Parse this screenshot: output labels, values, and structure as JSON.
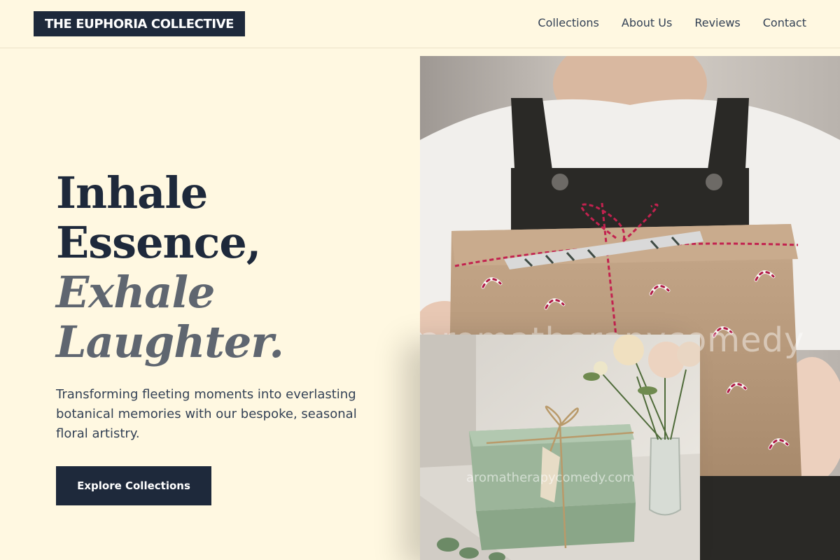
{
  "brand": {
    "name": "THE EUPHORIA COLLECTIVE"
  },
  "nav": {
    "items": [
      {
        "label": "Collections"
      },
      {
        "label": "About Us"
      },
      {
        "label": "Reviews"
      },
      {
        "label": "Contact"
      }
    ]
  },
  "hero": {
    "headline": {
      "line1": "Inhale",
      "line2": "Essence,",
      "line3": "Exhale",
      "line4": "Laughter."
    },
    "subtext": "Transforming fleeting moments into everlasting botanical memories with our bespoke, seasonal floral artistry.",
    "cta_label": "Explore Collections"
  },
  "images": {
    "main_watermark": "aromatherapycomedy",
    "inset_watermark": "aromatherapycomedy.com"
  },
  "colors": {
    "background": "#fff8e1",
    "primary": "#1e293b",
    "accent_muted": "#5f6670"
  }
}
